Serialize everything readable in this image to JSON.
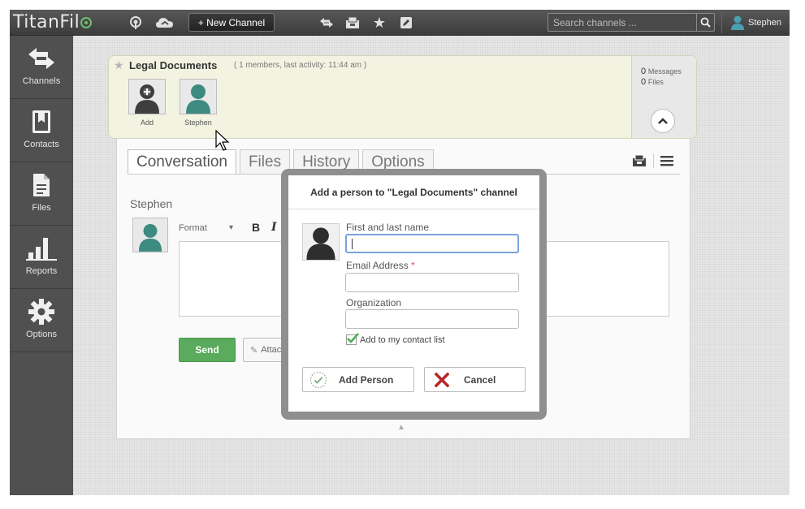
{
  "app": {
    "logo_text": "TitanFil",
    "new_channel_label": "+ New Channel",
    "search_placeholder": "Search channels ...",
    "user_name": "Stephen"
  },
  "sidebar": {
    "items": [
      {
        "label": "Channels",
        "icon": "arrows-icon"
      },
      {
        "label": "Contacts",
        "icon": "contacts-book-icon"
      },
      {
        "label": "Files",
        "icon": "file-icon"
      },
      {
        "label": "Reports",
        "icon": "bar-chart-icon"
      },
      {
        "label": "Options",
        "icon": "gear-icon"
      }
    ]
  },
  "channel": {
    "title": "Legal Documents",
    "meta": "( 1 members, last activity: 11:44 am )",
    "members": [
      {
        "label": "Add"
      },
      {
        "label": "Stephen"
      }
    ],
    "stats": {
      "messages_count": "0",
      "messages_label": "Messages",
      "files_count": "0",
      "files_label": "Files"
    }
  },
  "tabs": [
    "Conversation",
    "Files",
    "History",
    "Options"
  ],
  "composer": {
    "author": "Stephen",
    "format_label": "Format",
    "bold_label": "B",
    "italic_label": "I",
    "send_label": "Send",
    "attach_label": "Attac"
  },
  "modal": {
    "title": "Add a person to \"Legal Documents\" channel",
    "name_label": "First and last name",
    "name_value": "",
    "email_label": "Email Address",
    "required_mark": "*",
    "org_label": "Organization",
    "checkbox_label": "Add to my contact list",
    "checkbox_checked": true,
    "add_button": "Add Person",
    "cancel_button": "Cancel"
  },
  "colors": {
    "send_green": "#5aab5d",
    "cancel_red": "#b52a2a",
    "check_green": "#4caf50",
    "focus_blue": "#7aa3d9"
  }
}
